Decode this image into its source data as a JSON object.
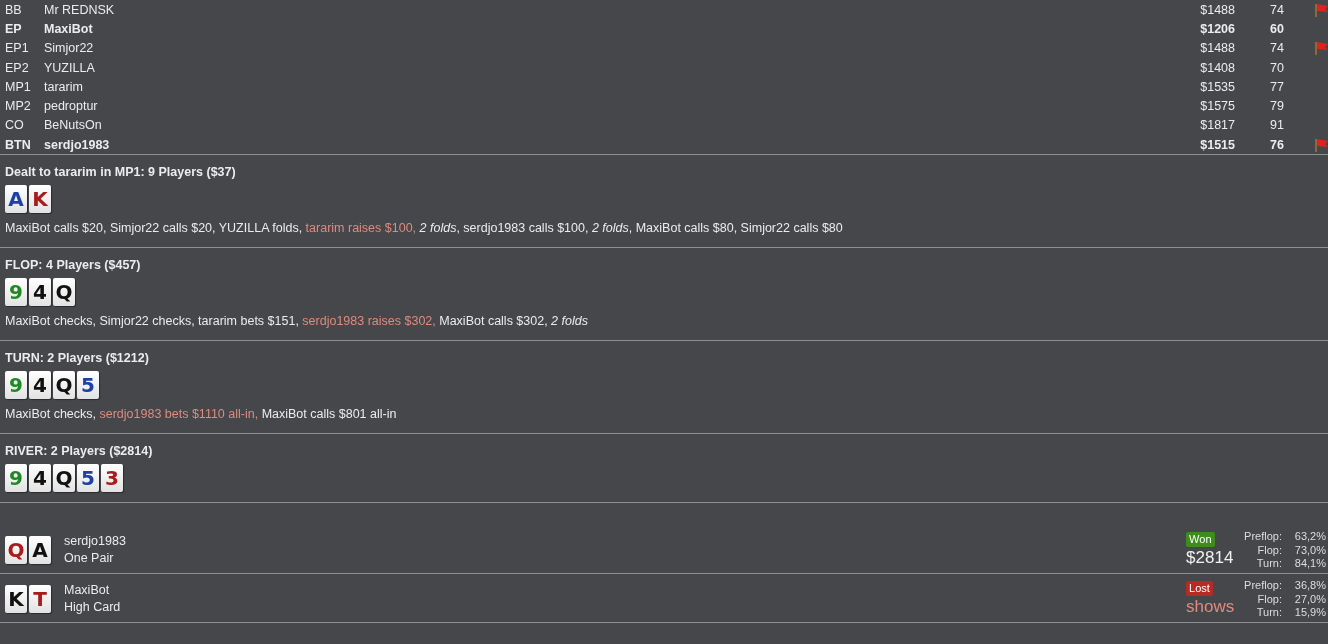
{
  "players": [
    {
      "position": "BB",
      "name": "Mr REDNSK",
      "stack": "$1488",
      "score": "74",
      "flagged": true,
      "highlighted": false
    },
    {
      "position": "EP",
      "name": "MaxiBot",
      "stack": "$1206",
      "score": "60",
      "flagged": false,
      "highlighted": true
    },
    {
      "position": "EP1",
      "name": "Simjor22",
      "stack": "$1488",
      "score": "74",
      "flagged": true,
      "highlighted": false
    },
    {
      "position": "EP2",
      "name": "YUZILLA",
      "stack": "$1408",
      "score": "70",
      "flagged": false,
      "highlighted": false
    },
    {
      "position": "MP1",
      "name": "tararim",
      "stack": "$1535",
      "score": "77",
      "flagged": false,
      "highlighted": false
    },
    {
      "position": "MP2",
      "name": "pedroptur",
      "stack": "$1575",
      "score": "79",
      "flagged": false,
      "highlighted": false
    },
    {
      "position": "CO",
      "name": "BeNutsOn",
      "stack": "$1817",
      "score": "91",
      "flagged": false,
      "highlighted": false
    },
    {
      "position": "BTN",
      "name": "serdjo1983",
      "stack": "$1515",
      "score": "76",
      "flagged": true,
      "highlighted": true
    }
  ],
  "streets": [
    {
      "title": "Dealt to tararim in MP1: 9 Players ($37)",
      "cards": [
        {
          "rank": "A",
          "color": "#1d3fa6"
        },
        {
          "rank": "K",
          "color": "#a81c1c"
        }
      ],
      "actions": [
        {
          "text": "MaxiBot calls $20, Simjor22 calls $20, YUZILLA folds, ",
          "kind": "plain"
        },
        {
          "text": "tararim raises $100, ",
          "kind": "highlight"
        },
        {
          "text": "2 folds",
          "kind": "italic"
        },
        {
          "text": ", serdjo1983 calls $100, ",
          "kind": "plain"
        },
        {
          "text": "2 folds",
          "kind": "italic"
        },
        {
          "text": ", MaxiBot calls $80, Simjor22 calls $80",
          "kind": "plain"
        }
      ]
    },
    {
      "title": "FLOP: 4 Players ($457)",
      "cards": [
        {
          "rank": "9",
          "color": "#1f8a24"
        },
        {
          "rank": "4",
          "color": "#111111"
        },
        {
          "rank": "Q",
          "color": "#111111"
        }
      ],
      "actions": [
        {
          "text": "MaxiBot checks, Simjor22 checks, tararim bets $151, ",
          "kind": "plain"
        },
        {
          "text": "serdjo1983 raises $302, ",
          "kind": "highlight"
        },
        {
          "text": "MaxiBot calls $302, ",
          "kind": "plain"
        },
        {
          "text": "2 folds",
          "kind": "italic"
        }
      ]
    },
    {
      "title": "TURN: 2 Players ($1212)",
      "cards": [
        {
          "rank": "9",
          "color": "#1f8a24"
        },
        {
          "rank": "4",
          "color": "#111111"
        },
        {
          "rank": "Q",
          "color": "#111111"
        },
        {
          "rank": "5",
          "color": "#1d3fa6"
        }
      ],
      "actions": [
        {
          "text": "MaxiBot checks, ",
          "kind": "plain"
        },
        {
          "text": "serdjo1983 bets $1110 all-in, ",
          "kind": "highlight"
        },
        {
          "text": "MaxiBot calls $801 all-in",
          "kind": "plain"
        }
      ]
    },
    {
      "title": "RIVER: 2 Players ($2814)",
      "cards": [
        {
          "rank": "9",
          "color": "#1f8a24"
        },
        {
          "rank": "4",
          "color": "#111111"
        },
        {
          "rank": "Q",
          "color": "#111111"
        },
        {
          "rank": "5",
          "color": "#1d3fa6"
        },
        {
          "rank": "3",
          "color": "#a81c1c"
        }
      ]
    }
  ],
  "results": [
    {
      "cards": [
        {
          "rank": "Q",
          "color": "#a81c1c"
        },
        {
          "rank": "A",
          "color": "#111111"
        }
      ],
      "player": "serdjo1983",
      "hand": "One Pair",
      "kind": "won",
      "badge": "Won",
      "amount": "$2814",
      "equity": [
        {
          "label": "Preflop:",
          "value": "63,2%"
        },
        {
          "label": "Flop:",
          "value": "73,0%"
        },
        {
          "label": "Turn:",
          "value": "84,1%"
        }
      ]
    },
    {
      "cards": [
        {
          "rank": "K",
          "color": "#111111"
        },
        {
          "rank": "T",
          "color": "#a81c1c"
        }
      ],
      "player": "MaxiBot",
      "hand": "High Card",
      "kind": "lost",
      "badge": "Lost",
      "amount": "shows",
      "equity": [
        {
          "label": "Preflop:",
          "value": "36,8%"
        },
        {
          "label": "Flop:",
          "value": "27,0%"
        },
        {
          "label": "Turn:",
          "value": "15,9%"
        }
      ]
    }
  ]
}
